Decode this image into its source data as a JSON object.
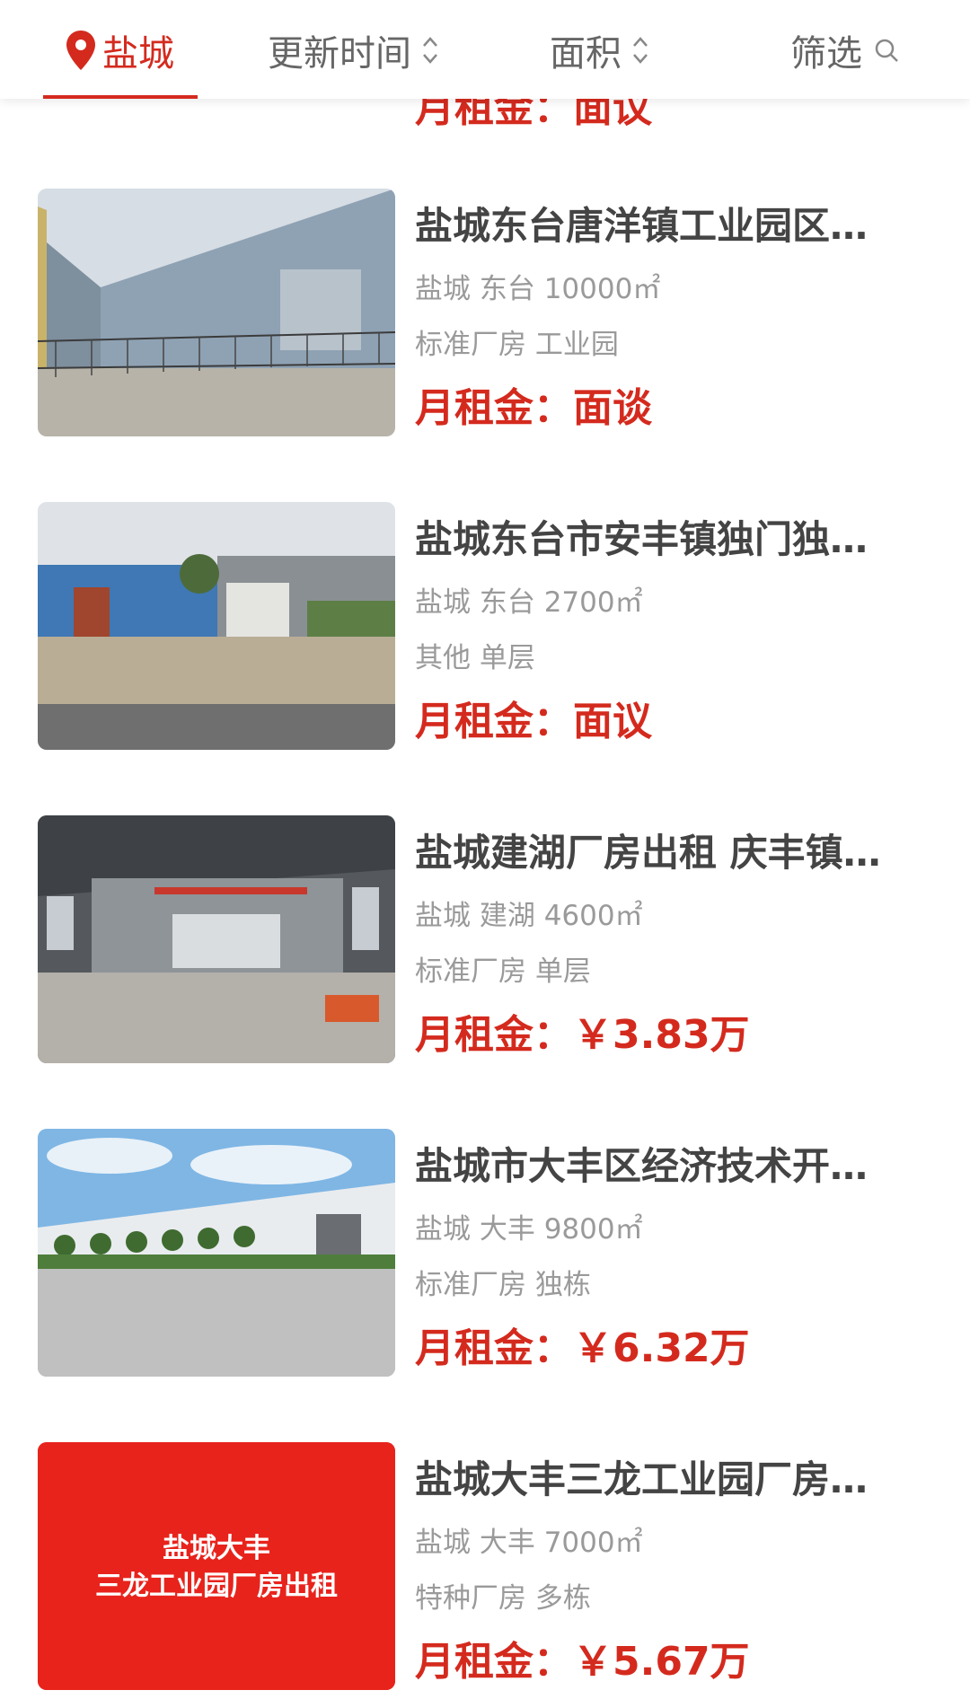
{
  "topbar": {
    "city_label": "盐城",
    "update_label": "更新时间",
    "area_label": "面积",
    "filter_label": "筛选"
  },
  "partial_top_price": "月租金：面议",
  "listings": [
    {
      "title": "盐城东台唐洋镇工业园区…",
      "location": "盐城 东台 10000㎡",
      "tags": "标准厂房 工业园",
      "price": "月租金：面谈"
    },
    {
      "title": "盐城东台市安丰镇独门独…",
      "location": "盐城 东台 2700㎡",
      "tags": "其他 单层",
      "price": "月租金：面议"
    },
    {
      "title": "盐城建湖厂房出租 庆丰镇…",
      "location": "盐城 建湖 4600㎡",
      "tags": "标准厂房 单层",
      "price": "月租金：￥3.83万"
    },
    {
      "title": "盐城市大丰区经济技术开…",
      "location": "盐城 大丰 9800㎡",
      "tags": "标准厂房 独栋",
      "price": "月租金：￥6.32万"
    },
    {
      "title": "盐城大丰三龙工业园厂房…",
      "location": "盐城 大丰 7000㎡",
      "tags": "特种厂房 多栋",
      "price": "月租金：￥5.67万",
      "banner_line1": "盐城大丰",
      "banner_line2": "三龙工业园厂房出租"
    }
  ],
  "colors": {
    "accent": "#d42a1e",
    "title": "#444444",
    "meta": "#9a9a9a"
  },
  "icons": [
    "location-pin-icon",
    "sort-icon",
    "search-icon"
  ]
}
